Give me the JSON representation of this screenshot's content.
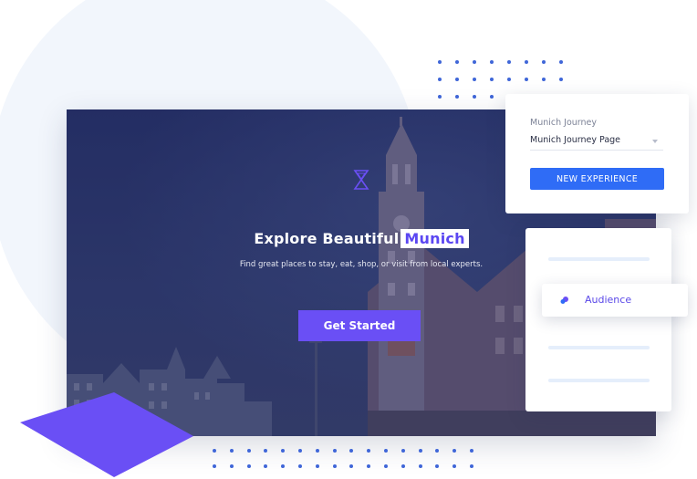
{
  "hero": {
    "title": "Explore Beautiful",
    "highlight": "Munich",
    "subtitle": "Find great places to stay, eat, shop, or visit from local experts.",
    "cta_label": "Get Started",
    "logo_icon": "hourglass-logo-icon"
  },
  "experience_card": {
    "label": "Munich Journey",
    "select_value": "Munich Journey Page",
    "button_label": "NEW EXPERIENCE"
  },
  "side_card": {
    "audience_label": "Audience",
    "audience_icon": "audience-icon"
  },
  "colors": {
    "accent_purple": "#6a4ff5",
    "primary_blue": "#2f6cf6",
    "dot_blue": "#3f66d8",
    "hero_overlay": "#27336a"
  }
}
